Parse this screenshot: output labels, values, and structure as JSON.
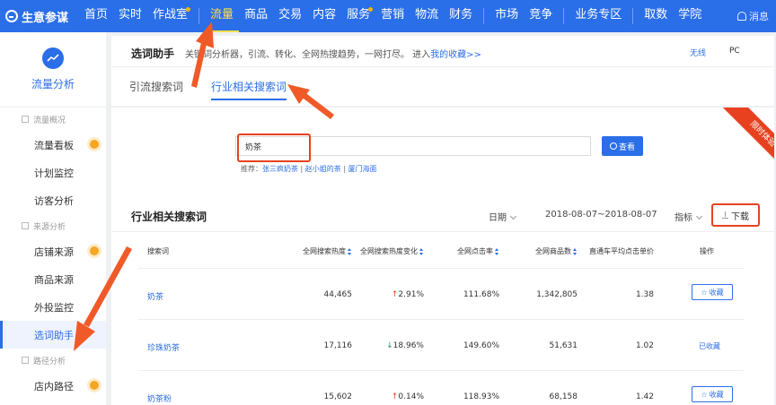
{
  "topbar": {
    "brand": "生意参谋",
    "nav": [
      {
        "label": "首页"
      },
      {
        "label": "实时"
      },
      {
        "label": "作战室",
        "dot": true
      },
      {
        "label": "流量",
        "active": true
      },
      {
        "label": "商品"
      },
      {
        "label": "交易"
      },
      {
        "label": "内容"
      },
      {
        "label": "服务",
        "dot": true
      },
      {
        "label": "营销"
      },
      {
        "label": "物流"
      },
      {
        "label": "财务"
      },
      {
        "label": "市场"
      },
      {
        "label": "竞争"
      },
      {
        "label": "业务专区"
      },
      {
        "label": "取数"
      },
      {
        "label": "学院"
      }
    ],
    "message": "消息"
  },
  "sidebar": {
    "title": "流量分析",
    "groups": [
      {
        "label": "流量概况",
        "items": [
          {
            "label": "流量看板",
            "dot": true
          },
          {
            "label": "计划监控"
          },
          {
            "label": "访客分析"
          }
        ]
      },
      {
        "label": "来源分析",
        "items": [
          {
            "label": "店铺来源",
            "dot": true
          },
          {
            "label": "商品来源"
          },
          {
            "label": "外投监控"
          },
          {
            "label": "选词助手",
            "active": true
          }
        ]
      },
      {
        "label": "路径分析",
        "items": [
          {
            "label": "店内路径",
            "dot": true
          }
        ]
      }
    ]
  },
  "header": {
    "title": "选词助手",
    "desc": "关键词分析器，引流、转化、全网热搜趋势，一网打尽。 进入",
    "link": "我的收藏>>",
    "switch_wireless": "无线",
    "switch_pc": "PC",
    "tabs": [
      {
        "label": "引流搜索词"
      },
      {
        "label": "行业相关搜索词",
        "active": true
      }
    ]
  },
  "trial_badge": "限时体验",
  "search": {
    "value": "奶茶",
    "button": "查看",
    "recommend_label": "推荐：",
    "recommend": [
      "张三疯奶茶",
      "赵小姐的茶",
      "厦门海面"
    ]
  },
  "section": {
    "title": "行业相关搜索词",
    "date_label": "日期",
    "date_range": "2018-08-07~2018-08-07",
    "indicator_label": "指标",
    "download": "下载"
  },
  "table": {
    "columns": [
      "搜索词",
      "全网搜索热度",
      "全网搜索热度变化",
      "全网点击率",
      "全网商品数",
      "直通车平均点击单价",
      "操作"
    ],
    "rows": [
      {
        "keyword": "奶茶",
        "heat": "44,465",
        "change": "2.91%",
        "change_dir": "up",
        "ctr": "111.68%",
        "items": "1,342,805",
        "cpc": "1.38",
        "action": "收藏",
        "favorited": false
      },
      {
        "keyword": "珍珠奶茶",
        "heat": "17,116",
        "change": "18.96%",
        "change_dir": "down",
        "ctr": "149.60%",
        "items": "51,631",
        "cpc": "1.02",
        "action": "已收藏",
        "favorited": true
      },
      {
        "keyword": "奶茶粉",
        "heat": "15,602",
        "change": "0.14%",
        "change_dir": "up",
        "ctr": "118.93%",
        "items": "68,158",
        "cpc": "1.42",
        "action": "收藏",
        "favorited": false
      }
    ]
  },
  "colors": {
    "primary": "#2a6ee8",
    "highlight": "#e8411f",
    "accent_dot": "#f5a623"
  }
}
